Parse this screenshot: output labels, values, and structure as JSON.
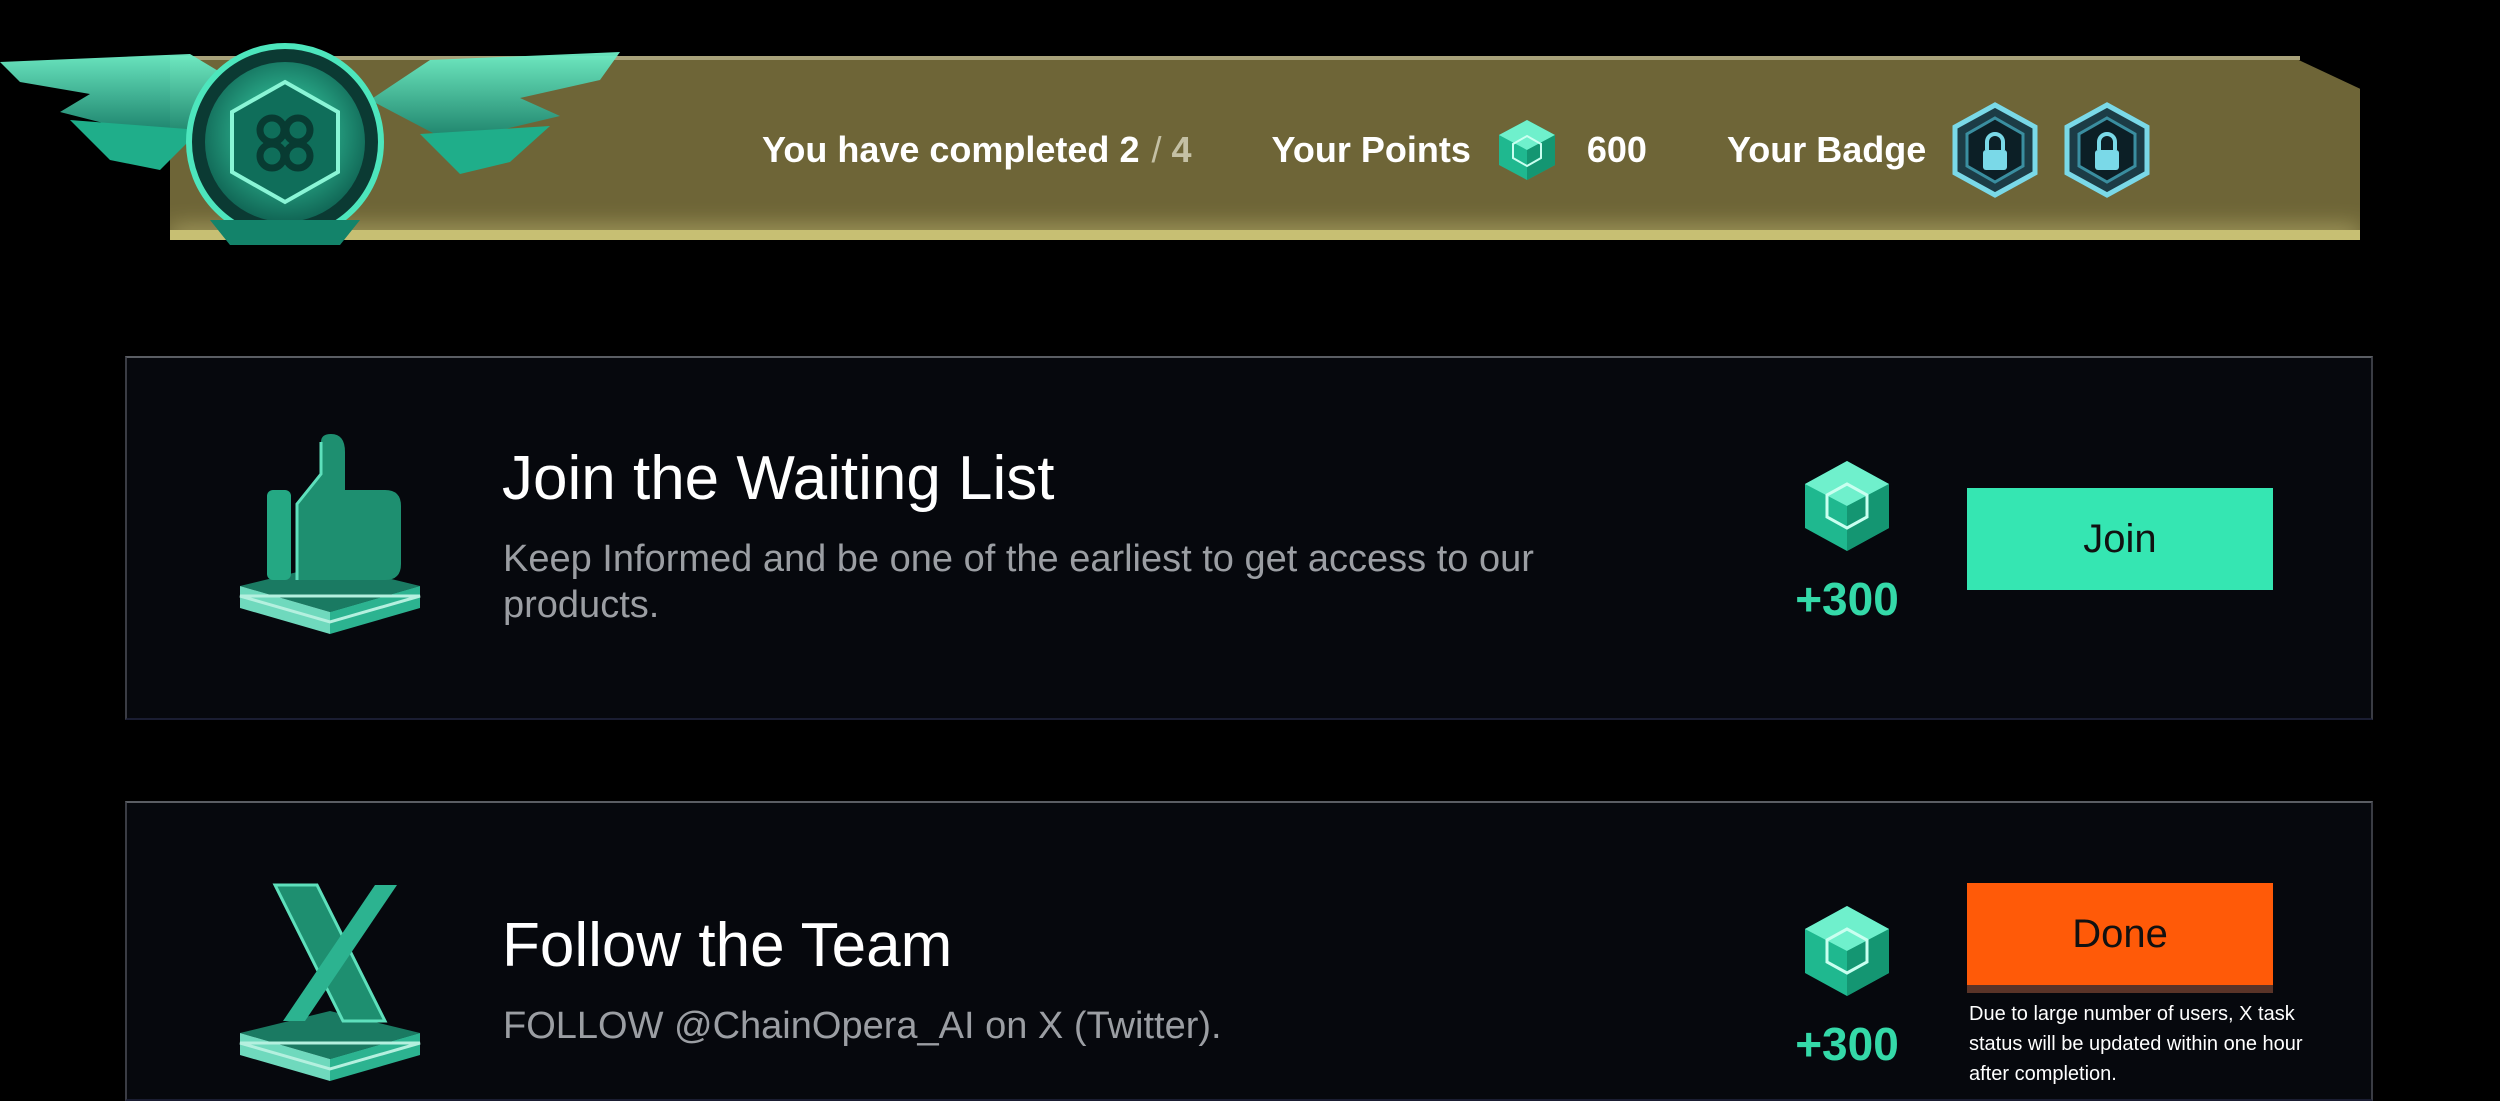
{
  "banner": {
    "completed_label": "You have completed",
    "completed_count": "2",
    "separator": "/",
    "completed_total": "4",
    "points_label": "Your Points",
    "points_value": "600",
    "badge_label": "Your Badge"
  },
  "tasks": [
    {
      "title": "Join the Waiting List",
      "description": "Keep Informed and be one of the earliest to get access to our products.",
      "reward": "+300",
      "button_label": "Join",
      "icon": "thumbs-up-icon"
    },
    {
      "title": "Follow the Team",
      "description": "FOLLOW @ChainOpera_AI on X (Twitter).",
      "reward": "+300",
      "button_label": "Done",
      "note": "Due to large number of users, X task status will be updated within one hour after completion.",
      "icon": "x-logo-icon"
    }
  ],
  "colors": {
    "background": "#000000",
    "banner": "#6e6537",
    "card": "#06080d",
    "accent_green": "#35e6b2",
    "reward_green": "#34d9a8",
    "done_orange": "#ff5a08"
  }
}
